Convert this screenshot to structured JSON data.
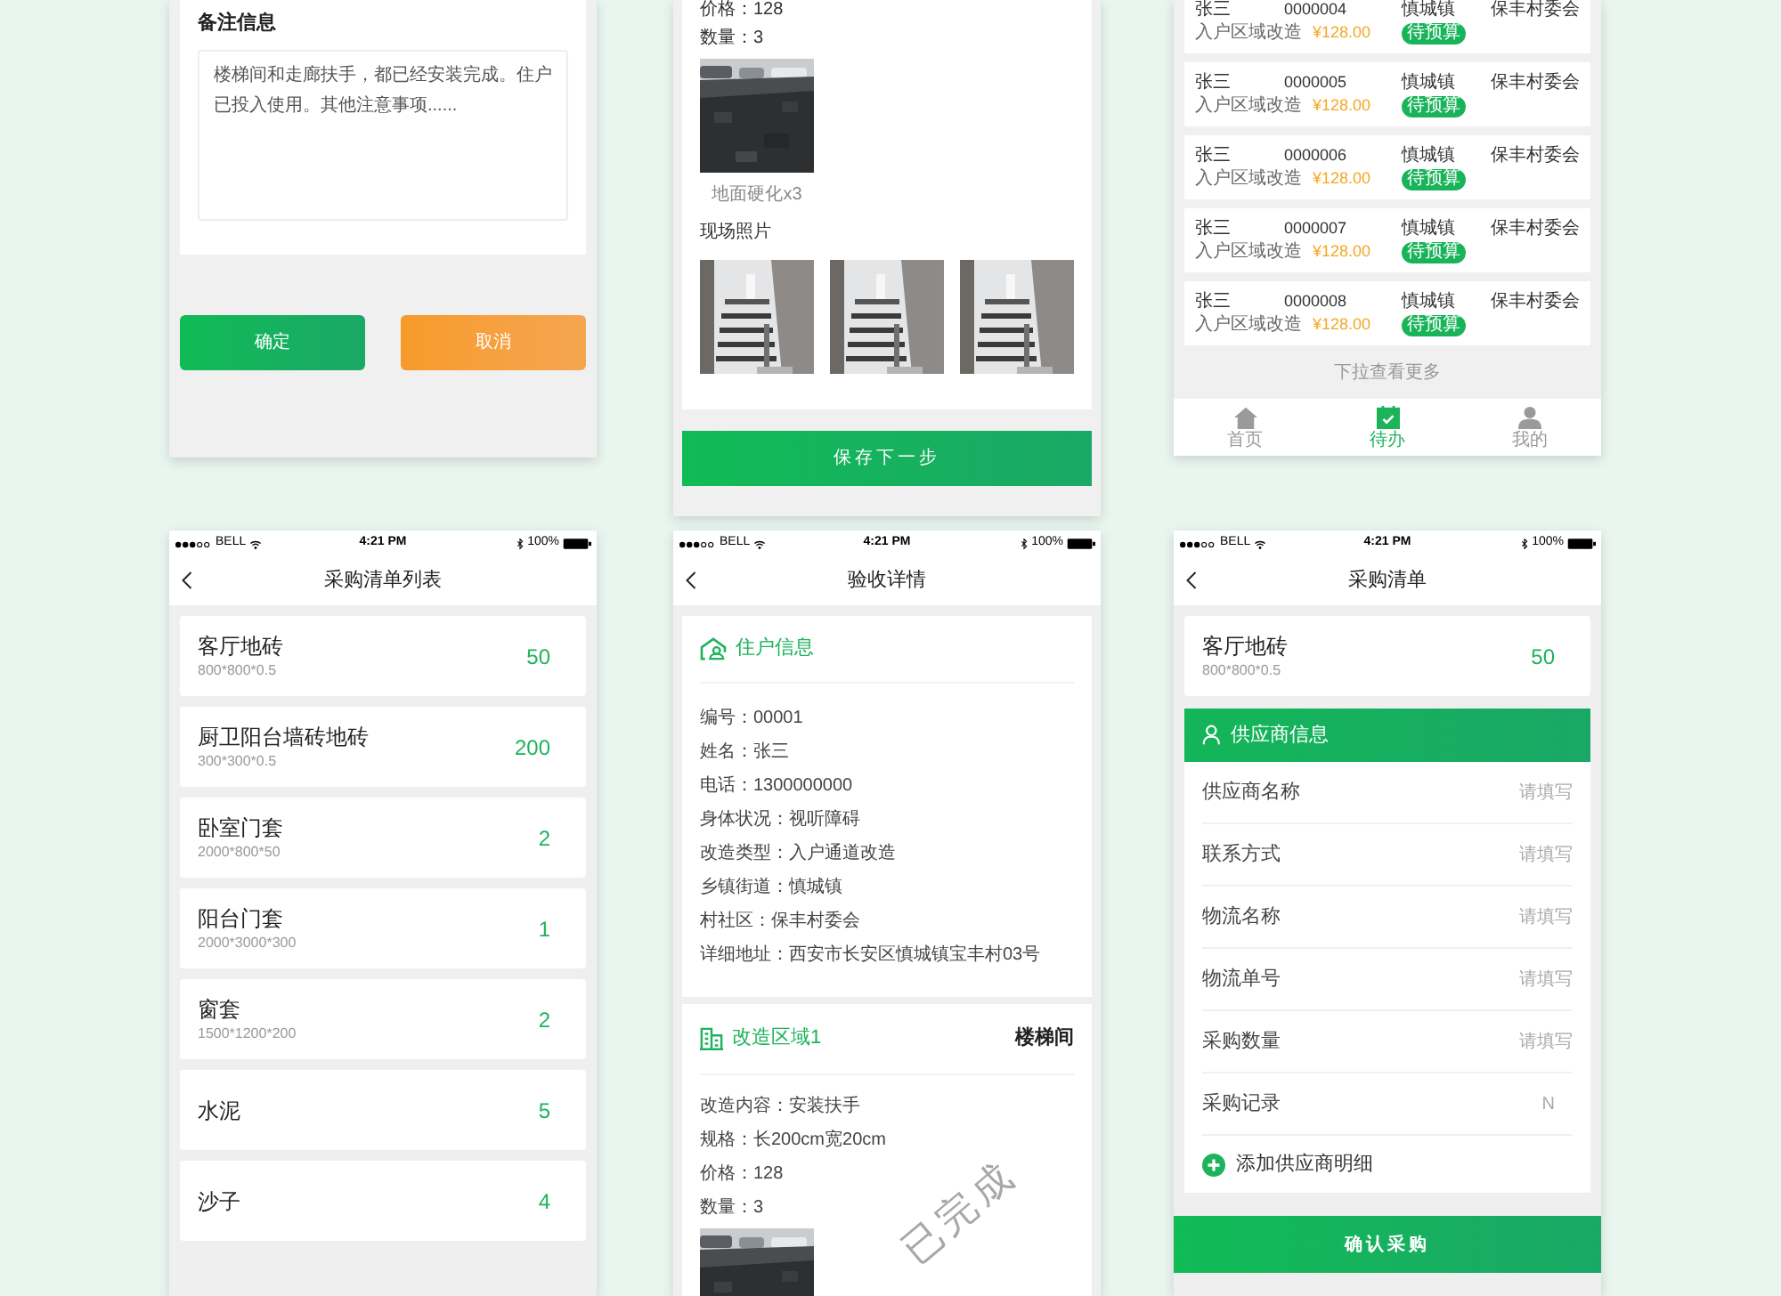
{
  "remarks_screen": {
    "heading": "备注信息",
    "remark": "楼梯间和走廊扶手，都已经安装完成。住户已投入使用。其他注意事项......",
    "buttons": [
      {
        "label": "确定",
        "kind": "confirm"
      },
      {
        "label": "取消",
        "kind": "cancel"
      }
    ]
  },
  "acceptance_continued_screen": {
    "fields": [
      "价格：128",
      "数量：3"
    ],
    "photos": [
      {
        "kind": "picture",
        "caption": "地面硬化x3"
      }
    ],
    "site_photos_heading": "现场照片",
    "site_photos": [
      {
        "kind": "picture"
      },
      {
        "kind": "picture"
      },
      {
        "kind": "picture"
      }
    ],
    "save_button": "保存下一步"
  },
  "todo_screen": {
    "rows": [
      {
        "name": "张三",
        "number": "0000004",
        "town": "慎城镇",
        "village": "保丰村委会",
        "type": "入户区域改造",
        "price": "¥128.00",
        "status": "待预算"
      },
      {
        "name": "张三",
        "number": "0000005",
        "town": "慎城镇",
        "village": "保丰村委会",
        "type": "入户区域改造",
        "price": "¥128.00",
        "status": "待预算"
      },
      {
        "name": "张三",
        "number": "0000006",
        "town": "慎城镇",
        "village": "保丰村委会",
        "type": "入户区域改造",
        "price": "¥128.00",
        "status": "待预算"
      },
      {
        "name": "张三",
        "number": "0000007",
        "town": "慎城镇",
        "village": "保丰村委会",
        "type": "入户区域改造",
        "price": "¥128.00",
        "status": "待预算"
      },
      {
        "name": "张三",
        "number": "0000008",
        "town": "慎城镇",
        "village": "保丰村委会",
        "type": "入户区域改造",
        "price": "¥128.00",
        "status": "待预算"
      }
    ],
    "more_hint": "下拉查看更多",
    "tabs": [
      {
        "label": "首页",
        "kind": "home",
        "selected": false
      },
      {
        "label": "待办",
        "kind": "todo",
        "selected": true
      },
      {
        "label": "我的",
        "kind": "profile",
        "selected": false
      }
    ]
  },
  "purchase_list_screen": {
    "status_bar": {
      "carrier": "BELL",
      "time": "4:21 PM",
      "battery": "100%"
    },
    "title": "采购清单列表",
    "items": [
      {
        "name": "客厅地砖",
        "spec": "800*800*0.5",
        "quantity": "50"
      },
      {
        "name": "厨卫阳台墙砖地砖",
        "spec": "300*300*0.5",
        "quantity": "200"
      },
      {
        "name": "卧室门套",
        "spec": "2000*800*50",
        "quantity": "2"
      },
      {
        "name": "阳台门套",
        "spec": "2000*3000*300",
        "quantity": "1"
      },
      {
        "name": "窗套",
        "spec": "1500*1200*200",
        "quantity": "2"
      },
      {
        "name": "水泥",
        "quantity": "5"
      },
      {
        "name": "沙子",
        "quantity": "4"
      }
    ]
  },
  "acceptance_detail_screen": {
    "status_bar": {
      "carrier": "BELL",
      "time": "4:21 PM",
      "battery": "100%"
    },
    "title": "验收详情",
    "resident_section": {
      "title": "住户信息",
      "fields": [
        "编号：00001",
        "姓名：张三",
        "电话：1300000000",
        "身体状况：视听障碍",
        "改造类型：入户通道改造",
        "乡镇街道：慎城镇",
        "村社区：保丰村委会",
        "详细地址：西安市长安区慎城镇宝丰村03号"
      ]
    },
    "area_section": {
      "title": "改造区域1",
      "location": "楼梯间",
      "fields": [
        "改造内容：安装扶手",
        "规格：长200cm宽20cm",
        "价格：128",
        "数量：3"
      ],
      "stamp": "已完成",
      "photos": [
        {
          "kind": "picture"
        }
      ]
    }
  },
  "purchase_screen": {
    "status_bar": {
      "carrier": "BELL",
      "time": "4:21 PM",
      "battery": "100%"
    },
    "title": "采购清单",
    "item": {
      "name": "客厅地砖",
      "spec": "800*800*0.5",
      "quantity": "50"
    },
    "supplier_header": "供应商信息",
    "fields": [
      {
        "label": "供应商名称",
        "placeholder": "请填写"
      },
      {
        "label": "联系方式",
        "placeholder": "请填写"
      },
      {
        "label": "物流名称",
        "placeholder": "请填写"
      },
      {
        "label": "物流单号",
        "placeholder": "请填写"
      },
      {
        "label": "采购数量",
        "placeholder": "请填写"
      },
      {
        "label": "采购记录",
        "value": "N"
      }
    ],
    "add_link": "添加供应商明细",
    "confirm_button": "确认采购"
  }
}
